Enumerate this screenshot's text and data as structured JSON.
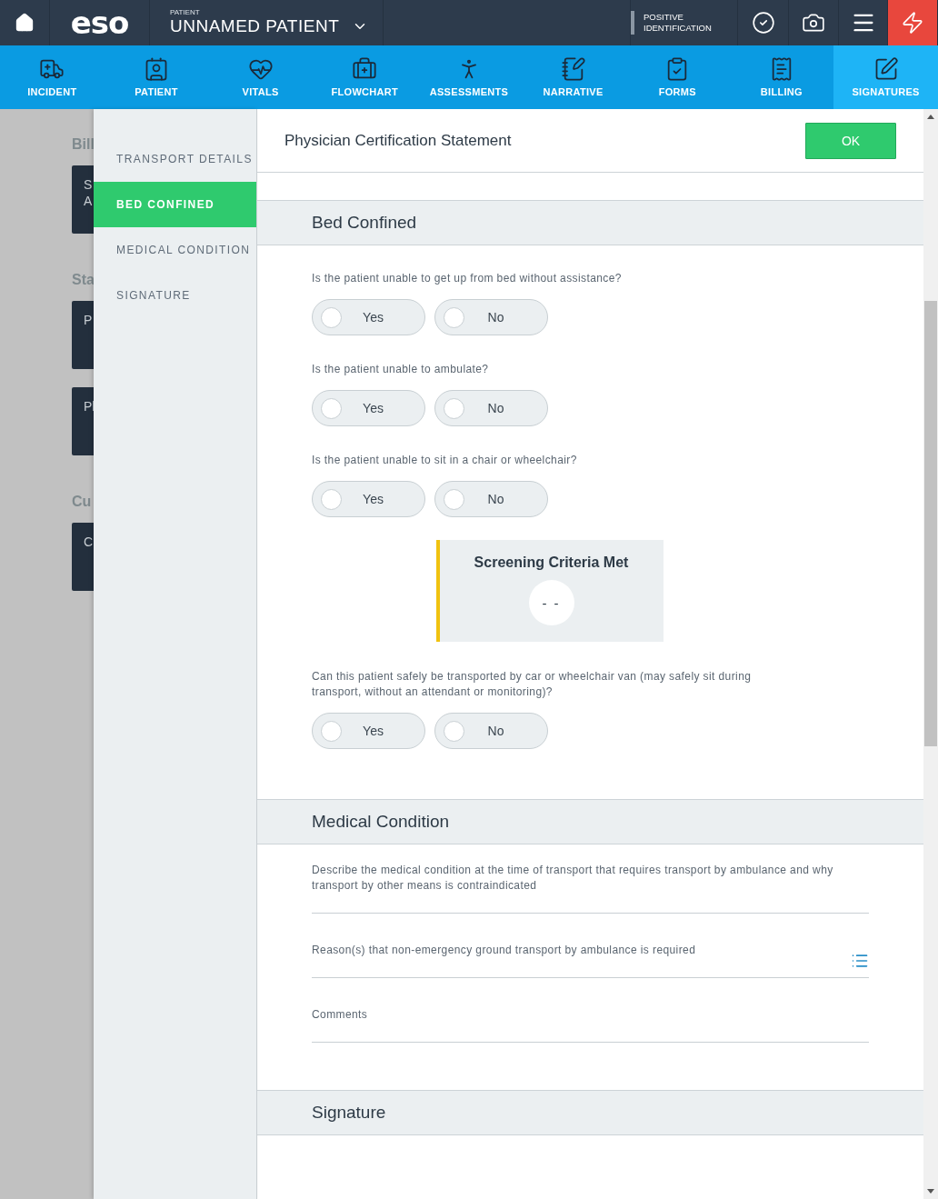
{
  "top_bar": {
    "logo": "eso",
    "patient_label": "PATIENT",
    "patient_name": "UNNAMED PATIENT",
    "positive_identification": "POSITIVE IDENTIFICATION"
  },
  "nav_tabs": [
    {
      "label": "INCIDENT",
      "selected": false
    },
    {
      "label": "PATIENT",
      "selected": false
    },
    {
      "label": "VITALS",
      "selected": false
    },
    {
      "label": "FLOWCHART",
      "selected": false
    },
    {
      "label": "ASSESSMENTS",
      "selected": false
    },
    {
      "label": "NARRATIVE",
      "selected": false
    },
    {
      "label": "FORMS",
      "selected": false
    },
    {
      "label": "BILLING",
      "selected": false
    },
    {
      "label": "SIGNATURES",
      "selected": true
    }
  ],
  "background": [
    {
      "heading": "Bill",
      "cards": [
        [
          "S",
          "A"
        ]
      ]
    },
    {
      "heading": "Sta",
      "cards": [
        [
          "P"
        ],
        [
          "Pl"
        ]
      ]
    },
    {
      "heading": "Cu",
      "cards": [
        [
          "C"
        ]
      ]
    }
  ],
  "side_nav": [
    {
      "label": "TRANSPORT DETAILS",
      "selected": false
    },
    {
      "label": "BED CONFINED",
      "selected": true
    },
    {
      "label": "MEDICAL CONDITION",
      "selected": false
    },
    {
      "label": "SIGNATURE",
      "selected": false
    }
  ],
  "dialog": {
    "title": "Physician Certification Statement",
    "ok": "OK"
  },
  "sections": [
    {
      "title": "Bed Confined",
      "items": [
        {
          "kind": "radio",
          "question": "Is the patient unable to get up from bed without assistance?",
          "options": [
            {
              "label": "Yes",
              "selected": false
            },
            {
              "label": "No",
              "selected": false
            }
          ]
        },
        {
          "kind": "radio",
          "question": "Is the patient unable to ambulate?",
          "options": [
            {
              "label": "Yes",
              "selected": false
            },
            {
              "label": "No",
              "selected": false
            }
          ]
        },
        {
          "kind": "radio",
          "question": "Is the patient unable to sit in a chair or wheelchair?",
          "options": [
            {
              "label": "Yes",
              "selected": false
            },
            {
              "label": "No",
              "selected": false
            }
          ]
        },
        {
          "kind": "criteria",
          "title": "Screening Criteria Met",
          "value": "- -"
        },
        {
          "kind": "radio",
          "question": "Can this patient safely be transported by car or wheelchair van (may safely sit during transport, without an attendant or monitoring)?",
          "options": [
            {
              "label": "Yes",
              "selected": false
            },
            {
              "label": "No",
              "selected": false
            }
          ]
        }
      ]
    },
    {
      "title": "Medical Condition",
      "items": [
        {
          "kind": "text",
          "label": "Describe the medical condition at the time of transport that requires transport by ambulance and why transport by other means is contraindicated"
        },
        {
          "kind": "list",
          "label": "Reason(s) that non-emergency ground transport by ambulance is required"
        },
        {
          "kind": "text",
          "label": "Comments"
        }
      ]
    },
    {
      "title": "Signature"
    }
  ]
}
